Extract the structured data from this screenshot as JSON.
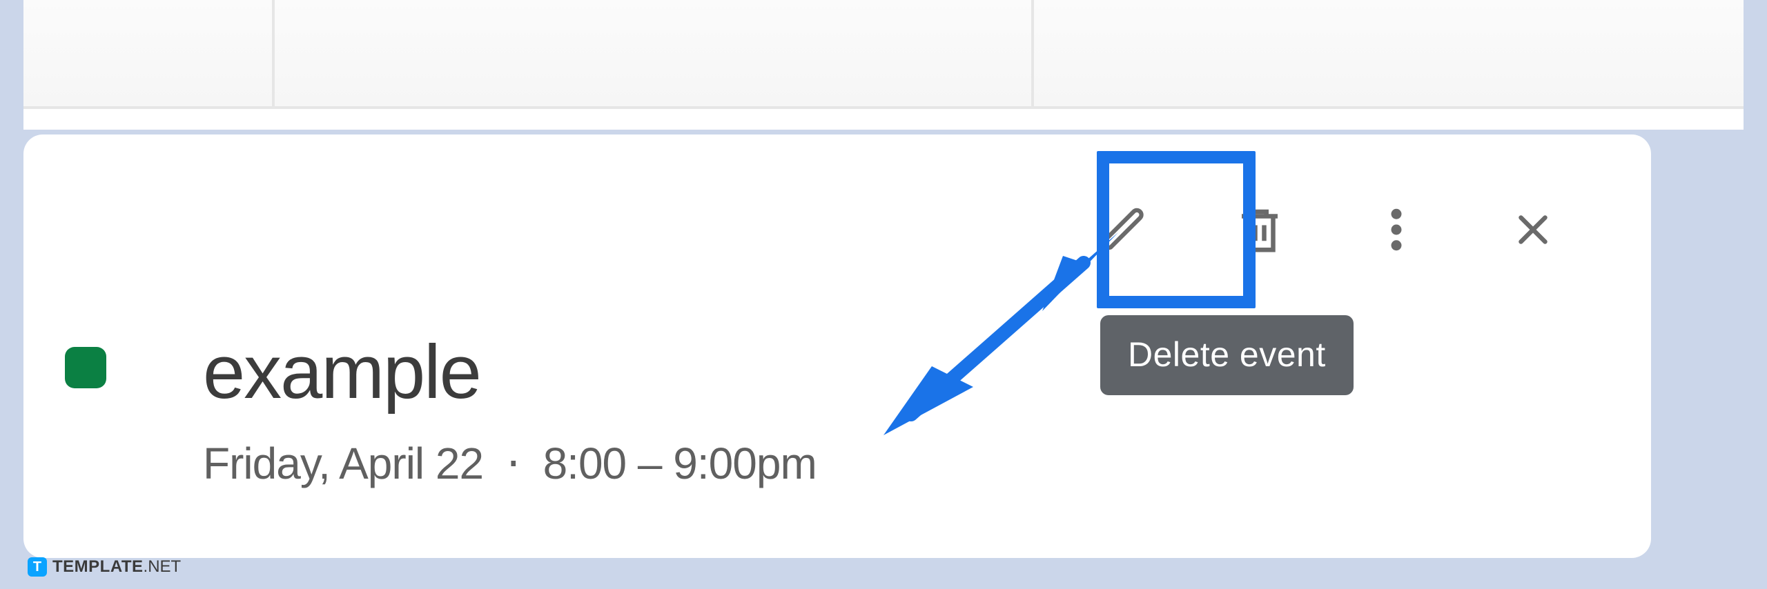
{
  "event": {
    "color": "#0b8043",
    "title": "example",
    "date_label": "Friday, April 22",
    "time_label": "8:00 – 9:00pm"
  },
  "toolbar": {
    "edit_name": "edit-event",
    "delete_name": "delete-event",
    "more_name": "more-options",
    "close_name": "close"
  },
  "tooltip": {
    "delete": "Delete event"
  },
  "annotation": {
    "highlight_target": "delete-event"
  },
  "watermark": {
    "brand_bold": "TEMPLATE",
    "brand_suffix": ".NET",
    "logo_letter": "T"
  }
}
